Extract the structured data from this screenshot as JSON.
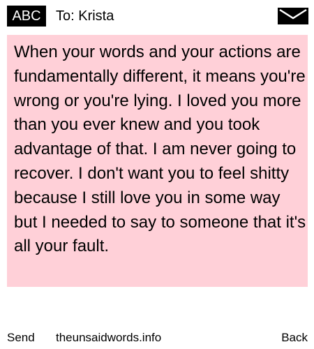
{
  "header": {
    "input_mode": "ABC",
    "recipient": "To: Krista",
    "icon": "envelope-icon"
  },
  "message": {
    "text": "When your words and your actions are fundamentally different, it means you're wrong or you're lying. I loved you more than you ever knew and you took advantage of that. I am never going to recover. I don't want you to feel shitty because I still love you in some way but I needed to say to someone that it's all your fault.",
    "background_color": "#ffd0d8"
  },
  "softkeys": {
    "left": "Send",
    "center": "theunsaidwords.info",
    "right": "Back"
  }
}
